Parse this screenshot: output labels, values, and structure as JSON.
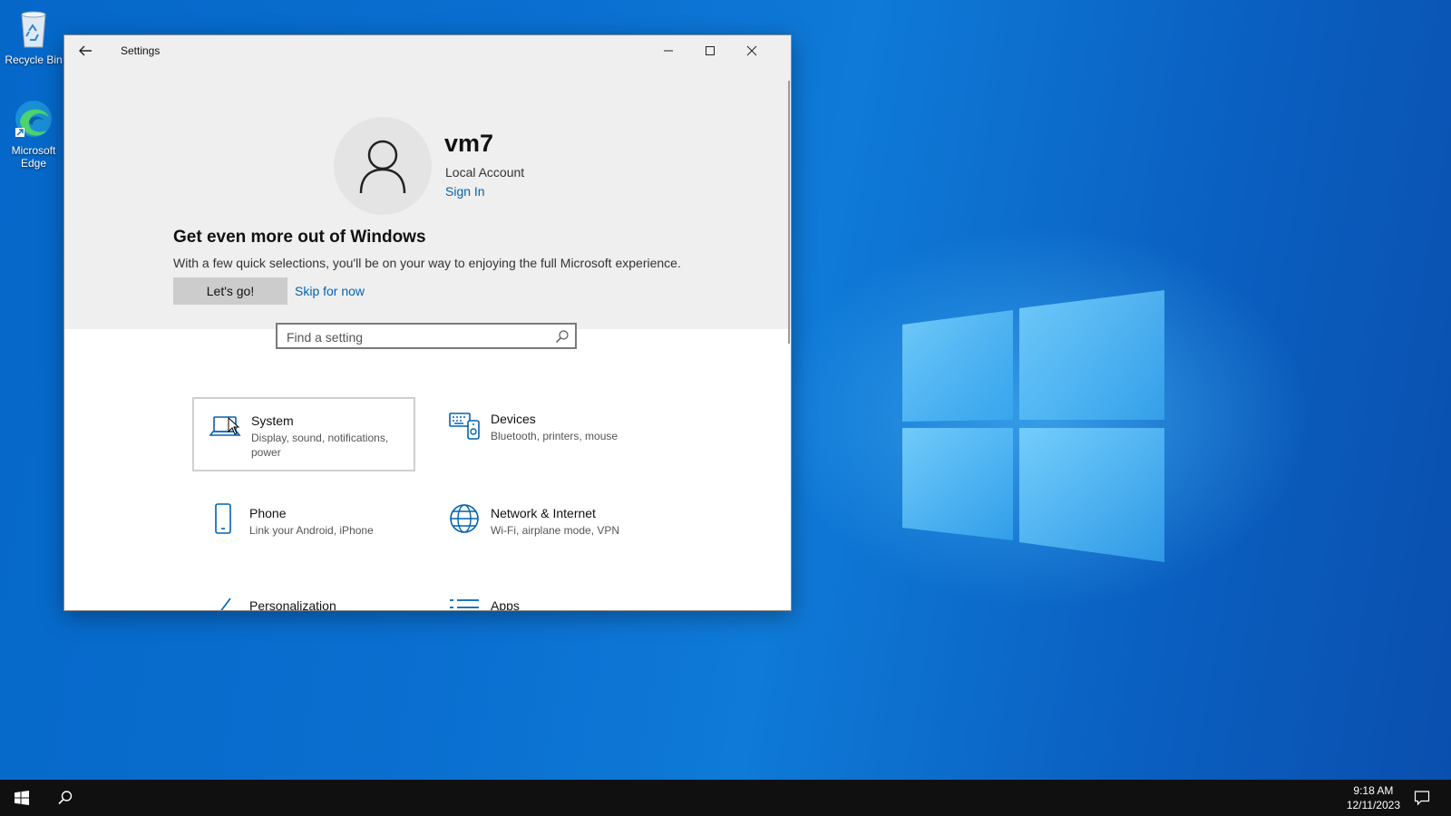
{
  "desktop": {
    "icons": [
      {
        "label": "Recycle Bin"
      },
      {
        "label": "Microsoft Edge"
      }
    ]
  },
  "window": {
    "title": "Settings",
    "account": {
      "username": "vm7",
      "type": "Local Account",
      "sign_in": "Sign In"
    },
    "promo": {
      "title": "Get even more out of Windows",
      "text": "With a few quick selections, you'll be on your way to enjoying the full Microsoft experience.",
      "go_button": "Let's go!",
      "skip_link": "Skip for now"
    },
    "search": {
      "placeholder": "Find a setting"
    },
    "tiles": [
      {
        "name": "System",
        "desc": "Display, sound, notifications, power",
        "icon": "laptop-icon"
      },
      {
        "name": "Devices",
        "desc": "Bluetooth, printers, mouse",
        "icon": "devices-icon"
      },
      {
        "name": "Phone",
        "desc": "Link your Android, iPhone",
        "icon": "phone-icon"
      },
      {
        "name": "Network & Internet",
        "desc": "Wi-Fi, airplane mode, VPN",
        "icon": "globe-icon"
      },
      {
        "name": "Personalization",
        "desc": "",
        "icon": "brush-icon"
      },
      {
        "name": "Apps",
        "desc": "",
        "icon": "apps-list-icon"
      }
    ]
  },
  "taskbar": {
    "time": "9:18 AM",
    "date": "12/11/2023"
  },
  "colors": {
    "accent": "#0063b1",
    "desktop": "#0a6fd0",
    "taskbar": "#101010"
  }
}
